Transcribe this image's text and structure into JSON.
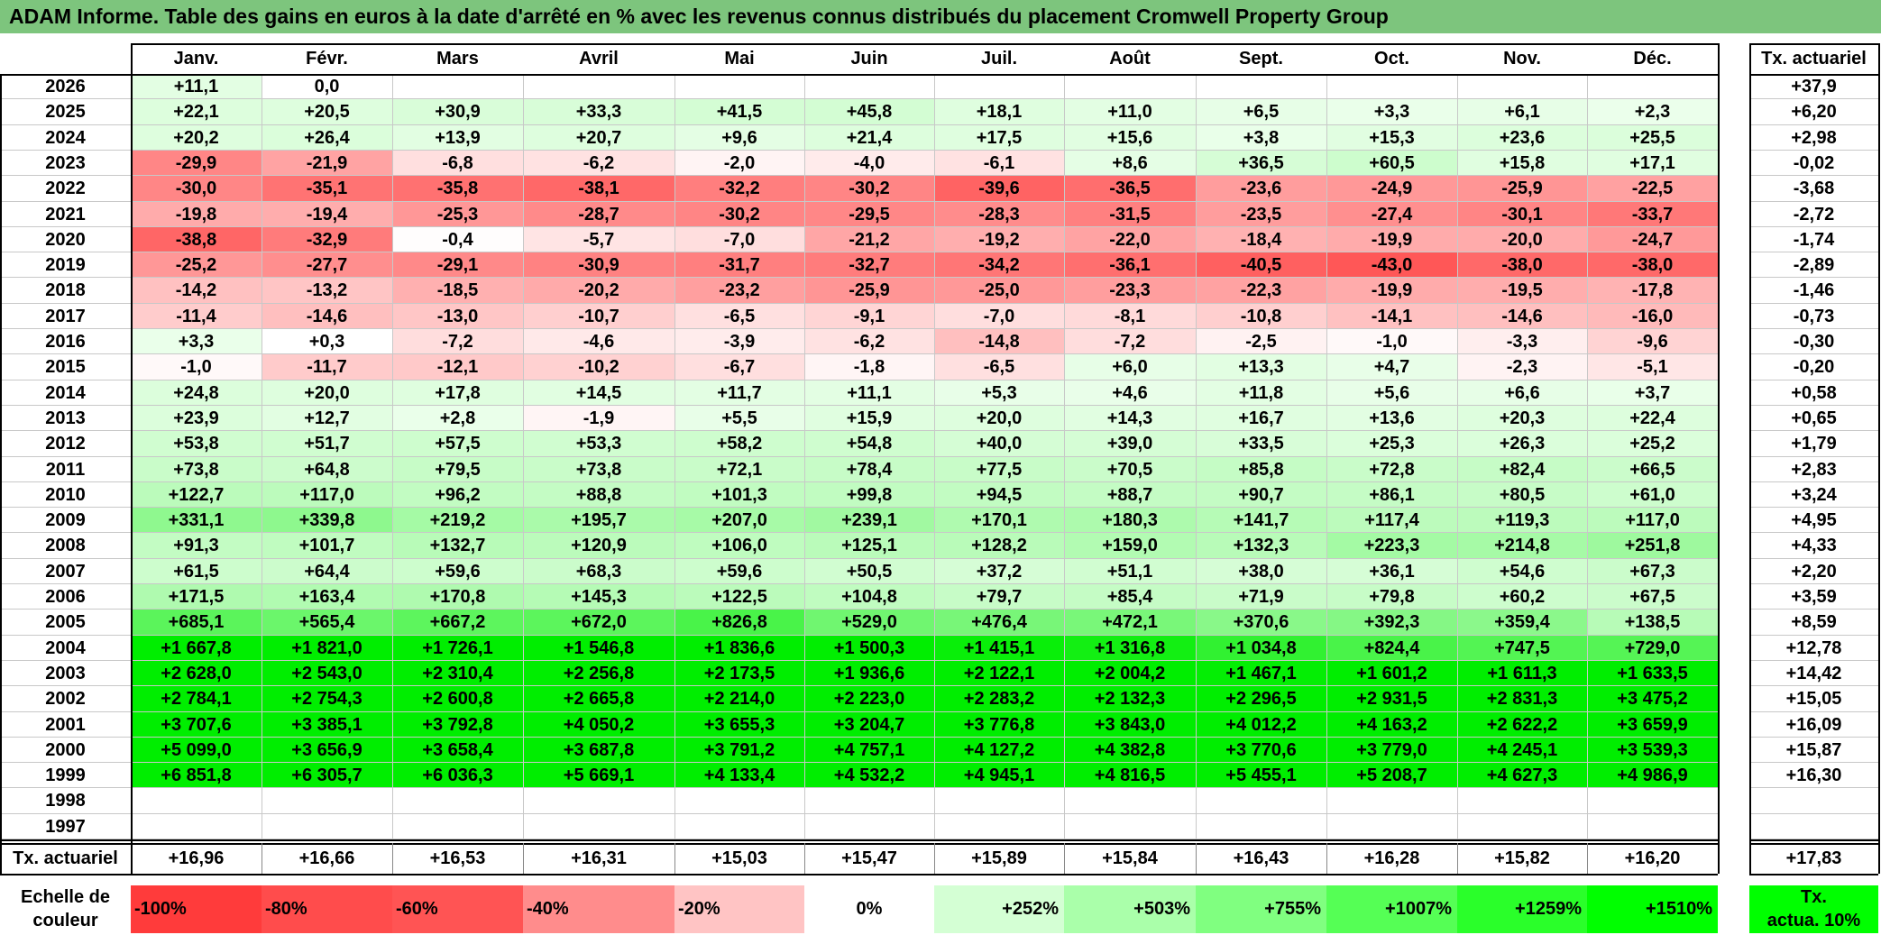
{
  "title": "ADAM Informe. Table des gains en euros à la date d'arrêté en % avec les revenus connus distribués du placement Cromwell Property Group",
  "chart_data": {
    "type": "table",
    "months": [
      "Janv.",
      "Févr.",
      "Mars",
      "Avril",
      "Mai",
      "Juin",
      "Juil.",
      "Août",
      "Sept.",
      "Oct.",
      "Nov.",
      "Déc."
    ],
    "annual_header": "Tx. actuariel",
    "rows": [
      {
        "year": "2026",
        "values": [
          "+11,1",
          "0,0",
          "",
          "",
          "",
          "",
          "",
          "",
          "",
          "",
          "",
          ""
        ],
        "rate": "+37,9"
      },
      {
        "year": "2025",
        "values": [
          "+22,1",
          "+20,5",
          "+30,9",
          "+33,3",
          "+41,5",
          "+45,8",
          "+18,1",
          "+11,0",
          "+6,5",
          "+3,3",
          "+6,1",
          "+2,3"
        ],
        "rate": "+6,20"
      },
      {
        "year": "2024",
        "values": [
          "+20,2",
          "+26,4",
          "+13,9",
          "+20,7",
          "+9,6",
          "+21,4",
          "+17,5",
          "+15,6",
          "+3,8",
          "+15,3",
          "+23,6",
          "+25,5"
        ],
        "rate": "+2,98"
      },
      {
        "year": "2023",
        "values": [
          "-29,9",
          "-21,9",
          "-6,8",
          "-6,2",
          "-2,0",
          "-4,0",
          "-6,1",
          "+8,6",
          "+36,5",
          "+60,5",
          "+15,8",
          "+17,1"
        ],
        "rate": "-0,02"
      },
      {
        "year": "2022",
        "values": [
          "-30,0",
          "-35,1",
          "-35,8",
          "-38,1",
          "-32,2",
          "-30,2",
          "-39,6",
          "-36,5",
          "-23,6",
          "-24,9",
          "-25,9",
          "-22,5"
        ],
        "rate": "-3,68"
      },
      {
        "year": "2021",
        "values": [
          "-19,8",
          "-19,4",
          "-25,3",
          "-28,7",
          "-30,2",
          "-29,5",
          "-28,3",
          "-31,5",
          "-23,5",
          "-27,4",
          "-30,1",
          "-33,7"
        ],
        "rate": "-2,72"
      },
      {
        "year": "2020",
        "values": [
          "-38,8",
          "-32,9",
          "-0,4",
          "-5,7",
          "-7,0",
          "-21,2",
          "-19,2",
          "-22,0",
          "-18,4",
          "-19,9",
          "-20,0",
          "-24,7"
        ],
        "rate": "-1,74"
      },
      {
        "year": "2019",
        "values": [
          "-25,2",
          "-27,7",
          "-29,1",
          "-30,9",
          "-31,7",
          "-32,7",
          "-34,2",
          "-36,1",
          "-40,5",
          "-43,0",
          "-38,0",
          "-38,0"
        ],
        "rate": "-2,89"
      },
      {
        "year": "2018",
        "values": [
          "-14,2",
          "-13,2",
          "-18,5",
          "-20,2",
          "-23,2",
          "-25,9",
          "-25,0",
          "-23,3",
          "-22,3",
          "-19,9",
          "-19,5",
          "-17,8"
        ],
        "rate": "-1,46"
      },
      {
        "year": "2017",
        "values": [
          "-11,4",
          "-14,6",
          "-13,0",
          "-10,7",
          "-6,5",
          "-9,1",
          "-7,0",
          "-8,1",
          "-10,8",
          "-14,1",
          "-14,6",
          "-16,0"
        ],
        "rate": "-0,73"
      },
      {
        "year": "2016",
        "values": [
          "+3,3",
          "+0,3",
          "-7,2",
          "-4,6",
          "-3,9",
          "-6,2",
          "-14,8",
          "-7,2",
          "-2,5",
          "-1,0",
          "-3,3",
          "-9,6"
        ],
        "rate": "-0,30"
      },
      {
        "year": "2015",
        "values": [
          "-1,0",
          "-11,7",
          "-12,1",
          "-10,2",
          "-6,7",
          "-1,8",
          "-6,5",
          "+6,0",
          "+13,3",
          "+4,7",
          "-2,3",
          "-5,1"
        ],
        "rate": "-0,20"
      },
      {
        "year": "2014",
        "values": [
          "+24,8",
          "+20,0",
          "+17,8",
          "+14,5",
          "+11,7",
          "+11,1",
          "+5,3",
          "+4,6",
          "+11,8",
          "+5,6",
          "+6,6",
          "+3,7"
        ],
        "rate": "+0,58"
      },
      {
        "year": "2013",
        "values": [
          "+23,9",
          "+12,7",
          "+2,8",
          "-1,9",
          "+5,5",
          "+15,9",
          "+20,0",
          "+14,3",
          "+16,7",
          "+13,6",
          "+20,3",
          "+22,4"
        ],
        "rate": "+0,65"
      },
      {
        "year": "2012",
        "values": [
          "+53,8",
          "+51,7",
          "+57,5",
          "+53,3",
          "+58,2",
          "+54,8",
          "+40,0",
          "+39,0",
          "+33,5",
          "+25,3",
          "+26,3",
          "+25,2"
        ],
        "rate": "+1,79"
      },
      {
        "year": "2011",
        "values": [
          "+73,8",
          "+64,8",
          "+79,5",
          "+73,8",
          "+72,1",
          "+78,4",
          "+77,5",
          "+70,5",
          "+85,8",
          "+72,8",
          "+82,4",
          "+66,5"
        ],
        "rate": "+2,83"
      },
      {
        "year": "2010",
        "values": [
          "+122,7",
          "+117,0",
          "+96,2",
          "+88,8",
          "+101,3",
          "+99,8",
          "+94,5",
          "+88,7",
          "+90,7",
          "+86,1",
          "+80,5",
          "+61,0"
        ],
        "rate": "+3,24"
      },
      {
        "year": "2009",
        "values": [
          "+331,1",
          "+339,8",
          "+219,2",
          "+195,7",
          "+207,0",
          "+239,1",
          "+170,1",
          "+180,3",
          "+141,7",
          "+117,4",
          "+119,3",
          "+117,0"
        ],
        "rate": "+4,95"
      },
      {
        "year": "2008",
        "values": [
          "+91,3",
          "+101,7",
          "+132,7",
          "+120,9",
          "+106,0",
          "+125,1",
          "+128,2",
          "+159,0",
          "+132,3",
          "+223,3",
          "+214,8",
          "+251,8"
        ],
        "rate": "+4,33"
      },
      {
        "year": "2007",
        "values": [
          "+61,5",
          "+64,4",
          "+59,6",
          "+68,3",
          "+59,6",
          "+50,5",
          "+37,2",
          "+51,1",
          "+38,0",
          "+36,1",
          "+54,6",
          "+67,3"
        ],
        "rate": "+2,20"
      },
      {
        "year": "2006",
        "values": [
          "+171,5",
          "+163,4",
          "+170,8",
          "+145,3",
          "+122,5",
          "+104,8",
          "+79,7",
          "+85,4",
          "+71,9",
          "+79,8",
          "+60,2",
          "+67,5"
        ],
        "rate": "+3,59"
      },
      {
        "year": "2005",
        "values": [
          "+685,1",
          "+565,4",
          "+667,2",
          "+672,0",
          "+826,8",
          "+529,0",
          "+476,4",
          "+472,1",
          "+370,6",
          "+392,3",
          "+359,4",
          "+138,5"
        ],
        "rate": "+8,59"
      },
      {
        "year": "2004",
        "values": [
          "+1 667,8",
          "+1 821,0",
          "+1 726,1",
          "+1 546,8",
          "+1 836,6",
          "+1 500,3",
          "+1 415,1",
          "+1 316,8",
          "+1 034,8",
          "+824,4",
          "+747,5",
          "+729,0"
        ],
        "rate": "+12,78"
      },
      {
        "year": "2003",
        "values": [
          "+2 628,0",
          "+2 543,0",
          "+2 310,4",
          "+2 256,8",
          "+2 173,5",
          "+1 936,6",
          "+2 122,1",
          "+2 004,2",
          "+1 467,1",
          "+1 601,2",
          "+1 611,3",
          "+1 633,5"
        ],
        "rate": "+14,42"
      },
      {
        "year": "2002",
        "values": [
          "+2 784,1",
          "+2 754,3",
          "+2 600,8",
          "+2 665,8",
          "+2 214,0",
          "+2 223,0",
          "+2 283,2",
          "+2 132,3",
          "+2 296,5",
          "+2 931,5",
          "+2 831,3",
          "+3 475,2"
        ],
        "rate": "+15,05"
      },
      {
        "year": "2001",
        "values": [
          "+3 707,6",
          "+3 385,1",
          "+3 792,8",
          "+4 050,2",
          "+3 655,3",
          "+3 204,7",
          "+3 776,8",
          "+3 843,0",
          "+4 012,2",
          "+4 163,2",
          "+2 622,2",
          "+3 659,9"
        ],
        "rate": "+16,09"
      },
      {
        "year": "2000",
        "values": [
          "+5 099,0",
          "+3 656,9",
          "+3 658,4",
          "+3 687,8",
          "+3 791,2",
          "+4 757,1",
          "+4 127,2",
          "+4 382,8",
          "+3 770,6",
          "+3 779,0",
          "+4 245,1",
          "+3 539,3"
        ],
        "rate": "+15,87"
      },
      {
        "year": "1999",
        "values": [
          "+6 851,8",
          "+6 305,7",
          "+6 036,3",
          "+5 669,1",
          "+4 133,4",
          "+4 532,2",
          "+4 945,1",
          "+4 816,5",
          "+5 455,1",
          "+5 208,7",
          "+4 627,3",
          "+4 986,9"
        ],
        "rate": "+16,30"
      },
      {
        "year": "1998",
        "values": [
          "",
          "",
          "",
          "",
          "",
          "",
          "",
          "",
          "",
          "",
          "",
          ""
        ],
        "rate": ""
      },
      {
        "year": "1997",
        "values": [
          "",
          "",
          "",
          "",
          "",
          "",
          "",
          "",
          "",
          "",
          "",
          ""
        ],
        "rate": ""
      }
    ],
    "footer": {
      "label": "Tx. actuariel",
      "values": [
        "+16,96",
        "+16,66",
        "+16,53",
        "+16,31",
        "+15,03",
        "+15,47",
        "+15,89",
        "+15,84",
        "+16,43",
        "+16,28",
        "+15,82",
        "+16,20"
      ],
      "total": "+17,83"
    },
    "legend": {
      "label_line1": "Echelle de",
      "label_line2": "couleur",
      "items": [
        {
          "label": "-100%",
          "color": "#ff3b3b"
        },
        {
          "label": "-80%",
          "color": "#ff4c4c"
        },
        {
          "label": "-60%",
          "color": "#ff5454"
        },
        {
          "label": "-40%",
          "color": "#ff8c8c"
        },
        {
          "label": "-20%",
          "color": "#ffc4c4"
        },
        {
          "label": "0%",
          "color": "#ffffff"
        },
        {
          "label": "+252%",
          "color": "#d4ffd4"
        },
        {
          "label": "+503%",
          "color": "#aaffaa"
        },
        {
          "label": "+755%",
          "color": "#80ff80"
        },
        {
          "label": "+1007%",
          "color": "#55ff55"
        },
        {
          "label": "+1259%",
          "color": "#2aff2a"
        },
        {
          "label": "+1510%",
          "color": "#00ff00"
        }
      ],
      "rate_label_line1": "Tx.",
      "rate_label_line2": "actua. 10%",
      "rate_color": "#00ff00"
    },
    "colors": {
      "title_bar": "#7dc57d",
      "negative_max": "#ff5050",
      "positive_max": "#00ee00"
    }
  }
}
